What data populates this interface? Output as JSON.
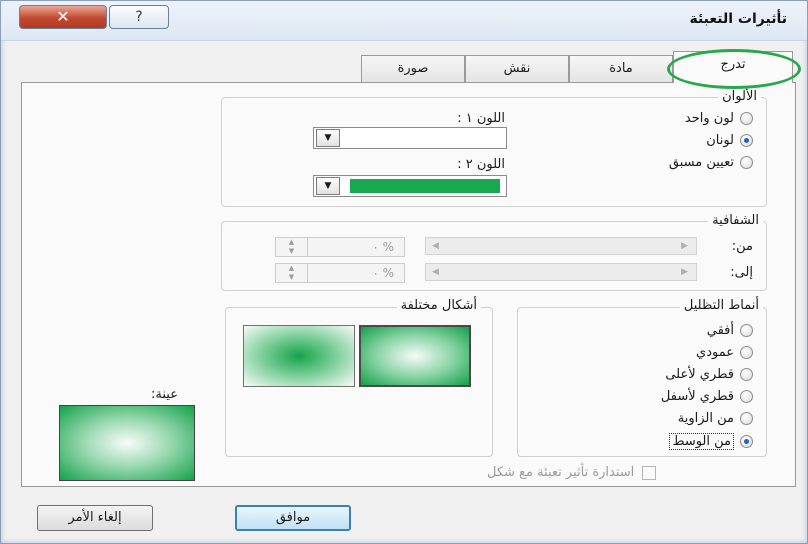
{
  "window": {
    "title": "تأثيرات التعبئة",
    "close_glyph": "✕",
    "help_glyph": "?"
  },
  "tabs": [
    {
      "label": "صورة"
    },
    {
      "label": "نقش"
    },
    {
      "label": "مادة"
    },
    {
      "label": "تدرج",
      "active": true
    }
  ],
  "colors_group": {
    "label": "الألوان",
    "options": [
      {
        "label": "لون واحد",
        "selected": false
      },
      {
        "label": "لونان",
        "selected": true
      },
      {
        "label": "تعيين مسبق",
        "selected": false
      }
    ],
    "color1_label": "اللون ١ :",
    "color2_label": "اللون ٢ :",
    "color2_value": "#18a850"
  },
  "transparency_group": {
    "label": "الشفافية",
    "from_label": "من:",
    "to_label": "إلى:",
    "from_value": "% ٠",
    "to_value": "% ٠"
  },
  "shading_group": {
    "label": "أنماط التظليل",
    "options": [
      {
        "label": "أفقي",
        "selected": false
      },
      {
        "label": "عمودي",
        "selected": false
      },
      {
        "label": "قطري لأعلى",
        "selected": false
      },
      {
        "label": "قطري لأسفل",
        "selected": false
      },
      {
        "label": "من الزاوية",
        "selected": false
      },
      {
        "label": "من الوسط",
        "selected": true
      }
    ]
  },
  "variants_group": {
    "label": "أشكال مختلفة"
  },
  "sample": {
    "label": "عينة:"
  },
  "rotate_option": {
    "label": "استدارة تأثير تعبئة مع شكل",
    "checked": false
  },
  "buttons": {
    "ok": "موافق",
    "cancel": "إلغاء الأمر"
  }
}
